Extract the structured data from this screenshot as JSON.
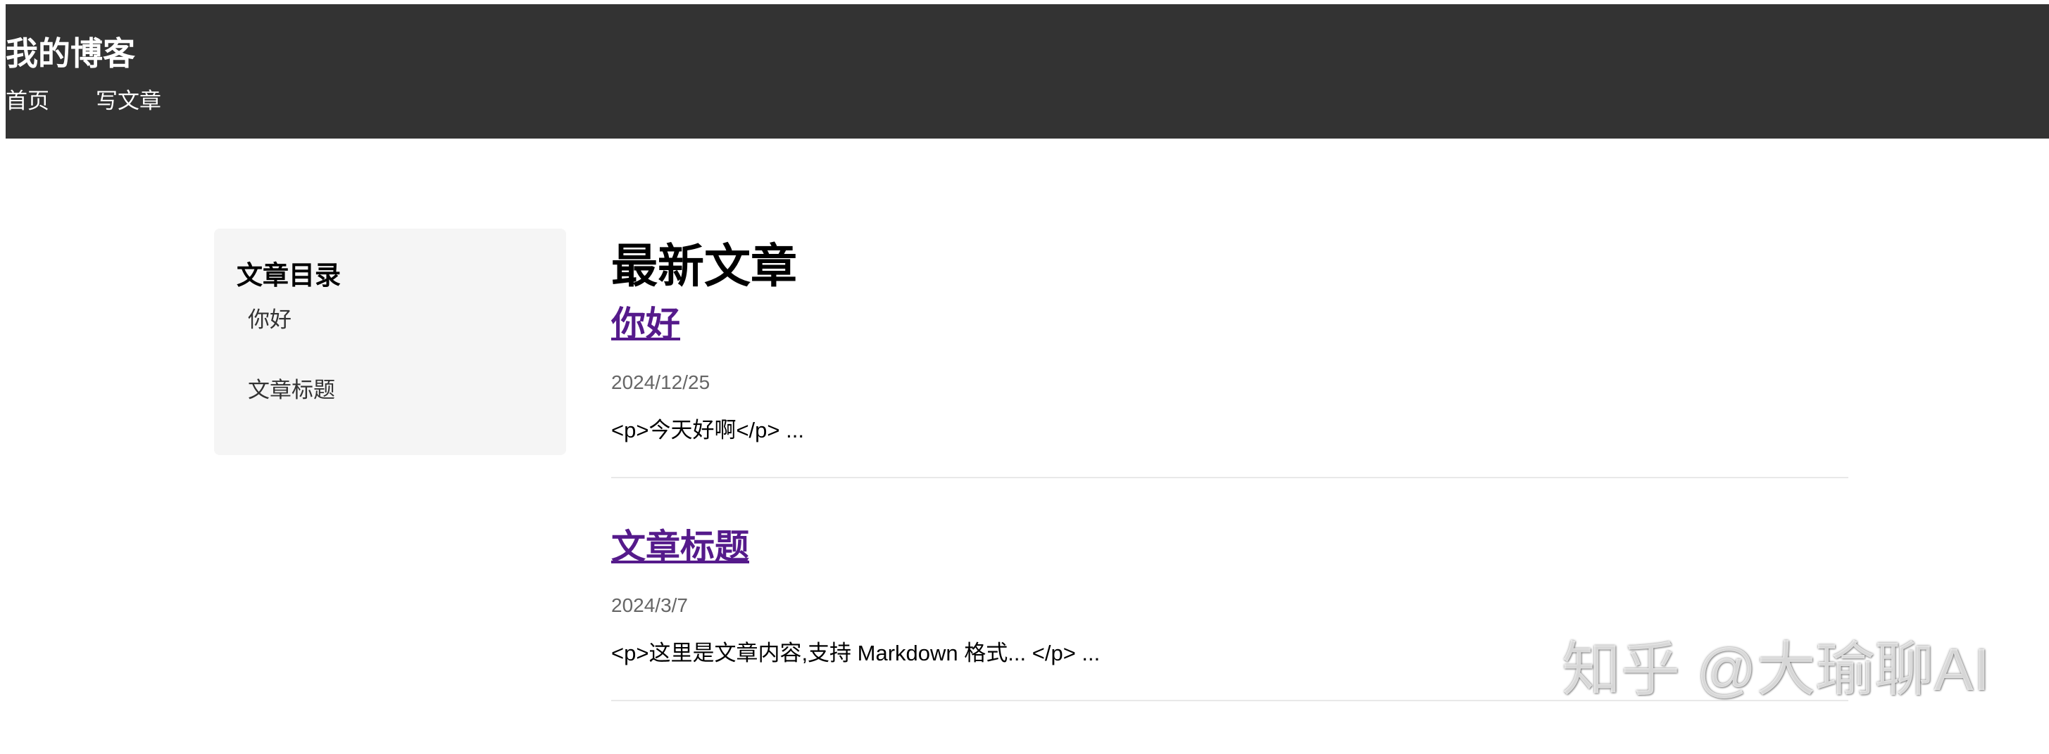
{
  "header": {
    "site_title": "我的博客",
    "nav": [
      {
        "label": "首页"
      },
      {
        "label": "写文章"
      }
    ]
  },
  "sidebar": {
    "title": "文章目录",
    "items": [
      {
        "label": "你好"
      },
      {
        "label": "文章标题"
      }
    ]
  },
  "main": {
    "title": "最新文章",
    "posts": [
      {
        "title": "你好",
        "date": "2024/12/25",
        "excerpt": "<p>今天好啊</p> ..."
      },
      {
        "title": "文章标题",
        "date": "2024/3/7",
        "excerpt": "<p>这里是文章内容,支持 Markdown 格式... </p> ..."
      }
    ]
  },
  "watermark": "知乎 @大瑜聊AI",
  "colors": {
    "header_bg": "#333333",
    "sidebar_bg": "#f5f5f5",
    "link_visited": "#551a8b",
    "date_text": "#666666"
  }
}
